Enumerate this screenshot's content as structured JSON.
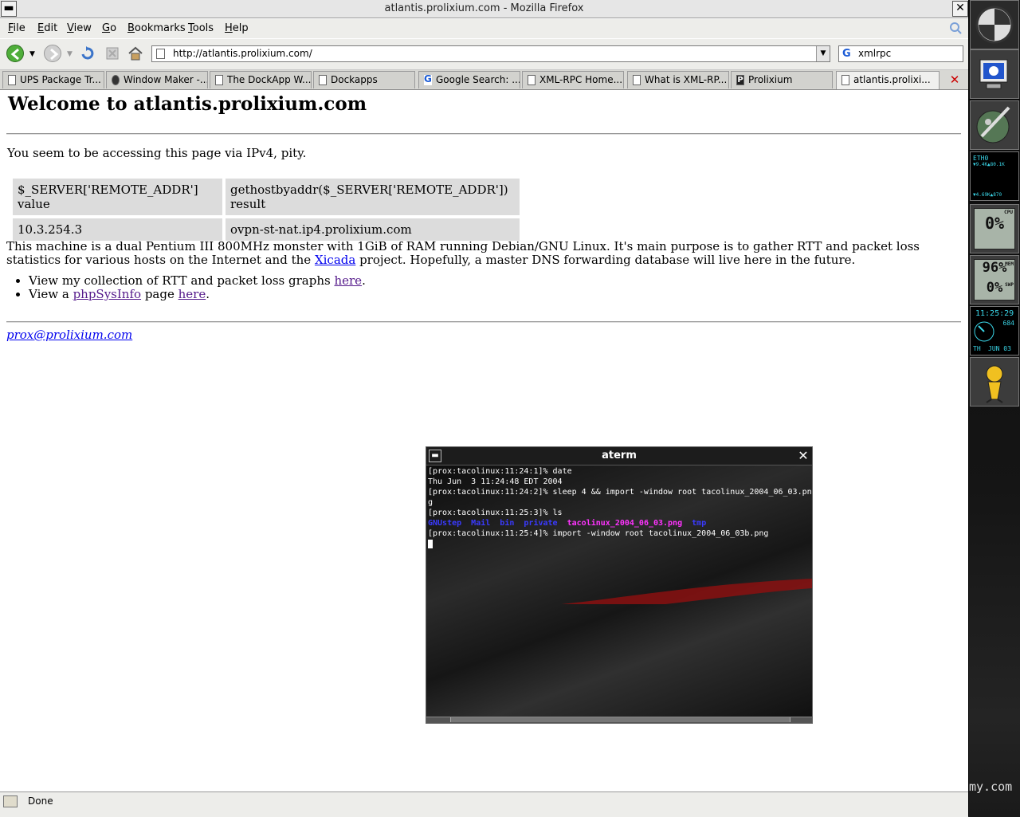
{
  "window": {
    "title": "atlantis.prolixium.com - Mozilla Firefox",
    "close_glyph": "✕"
  },
  "menu": [
    "File",
    "Edit",
    "View",
    "Go",
    "Bookmarks",
    "Tools",
    "Help"
  ],
  "menu_accel": [
    "F",
    "E",
    "V",
    "G",
    "B",
    "T",
    "H"
  ],
  "navbar": {
    "url": "http://atlantis.prolixium.com/",
    "search_value": "xmlrpc",
    "icons": [
      "back-icon",
      "forward-icon",
      "reload-icon",
      "stop-icon",
      "home-icon"
    ]
  },
  "tabs": [
    {
      "label": "UPS Package Tr...",
      "active": false
    },
    {
      "label": "Window Maker -...",
      "active": false
    },
    {
      "label": "The DockApp W...",
      "active": false
    },
    {
      "label": "Dockapps",
      "active": false
    },
    {
      "label": "Google Search: ...",
      "active": false
    },
    {
      "label": "XML-RPC Home...",
      "active": false
    },
    {
      "label": "What is XML-RP...",
      "active": false
    },
    {
      "label": "Prolixium",
      "active": false
    },
    {
      "label": "atlantis.prolixi...",
      "active": true
    }
  ],
  "page": {
    "heading": "Welcome to atlantis.prolixium.com",
    "ipv4_notice": "You seem to be accessing this page via IPv4, pity.",
    "table": {
      "headers": [
        "$_SERVER['REMOTE_ADDR'] value",
        "gethostbyaddr($_SERVER['REMOTE_ADDR']) result"
      ],
      "row": [
        "10.3.254.3",
        "ovpn-st-nat.ip4.prolixium.com"
      ]
    },
    "desc_part1": "This machine is a dual Pentium III 800MHz monster with 1GiB of RAM running Debian/GNU Linux.  It's main purpose is to gather RTT and packet loss statistics for various hosts on the Internet and the ",
    "desc_link": "Xicada",
    "desc_part2": " project.  Hopefully, a master DNS forwarding database will live here in the future.",
    "bullets": {
      "b1_text": "View my collection of RTT and packet loss graphs ",
      "b1_link": "here",
      "b2_text": "View a ",
      "b2_link1": "phpSysInfo",
      "b2_mid": " page ",
      "b2_link2": "here",
      "period": "."
    },
    "email": "prox@prolixium.com"
  },
  "status": {
    "text": "Done"
  },
  "aterm": {
    "title": "aterm",
    "lines": [
      "[prox:tacolinux:11:24:1]% date",
      "Thu Jun  3 11:24:48 EDT 2004",
      "[prox:tacolinux:11:24:2]% sleep 4 && import -window root tacolinux_2004_06_03.pn",
      "g",
      "[prox:tacolinux:11:25:3]% ls"
    ],
    "ls_blue1": "GNUstep  Mail  bin  private",
    "ls_magenta": "tacolinux_2004_06_03.png",
    "ls_blue2": "tmp",
    "last_line": "[prox:tacolinux:11:25:4]% import -window root tacolinux_2004_06_03b.png"
  },
  "dock": {
    "net_label": "ETH0",
    "net_up": "▼9.4K▲80.1K",
    "net_down": "▼4.69K▲870",
    "cpu_label": "CPU",
    "cpu_value": "0%",
    "mem_value": "96%",
    "swap_value": "0%",
    "mem_label": "MEM",
    "swap_label": "SWP",
    "time": "11:25:29",
    "seconds": "684",
    "day": "TH",
    "date": "JUN 03",
    "watermark": "my.com"
  },
  "colors": {
    "link": "#0000ee",
    "visited": "#551a8b",
    "terminal_bg": "#0a0a0a",
    "term_blue": "#3a3aff",
    "term_magenta": "#ff33ff"
  }
}
